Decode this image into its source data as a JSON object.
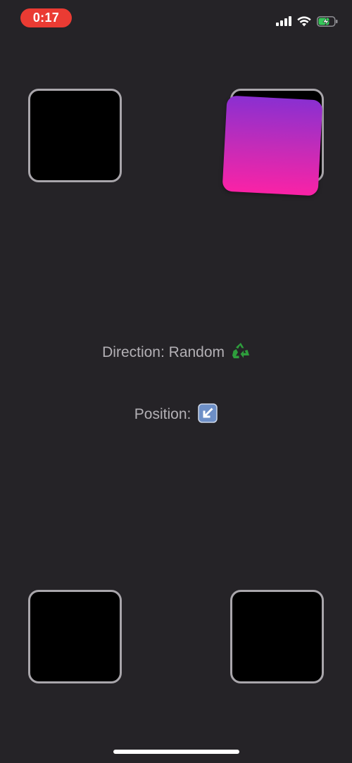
{
  "status_bar": {
    "time": "0:17",
    "icons": [
      "cellular-signal-icon",
      "wifi-icon",
      "battery-charging-icon"
    ],
    "time_pill_color": "#ea3b33",
    "battery_color": "#35c759"
  },
  "slots": [
    "top-left",
    "top-right",
    "bottom-left",
    "bottom-right"
  ],
  "card": {
    "gradient_top": "#8a2fd1",
    "gradient_bottom": "#fa22a6",
    "current_slot": "top-right"
  },
  "direction": {
    "label": "Direction: Random",
    "icon": "recycle-icon"
  },
  "position": {
    "label": "Position:",
    "icon": "arrow-down-left-icon"
  }
}
